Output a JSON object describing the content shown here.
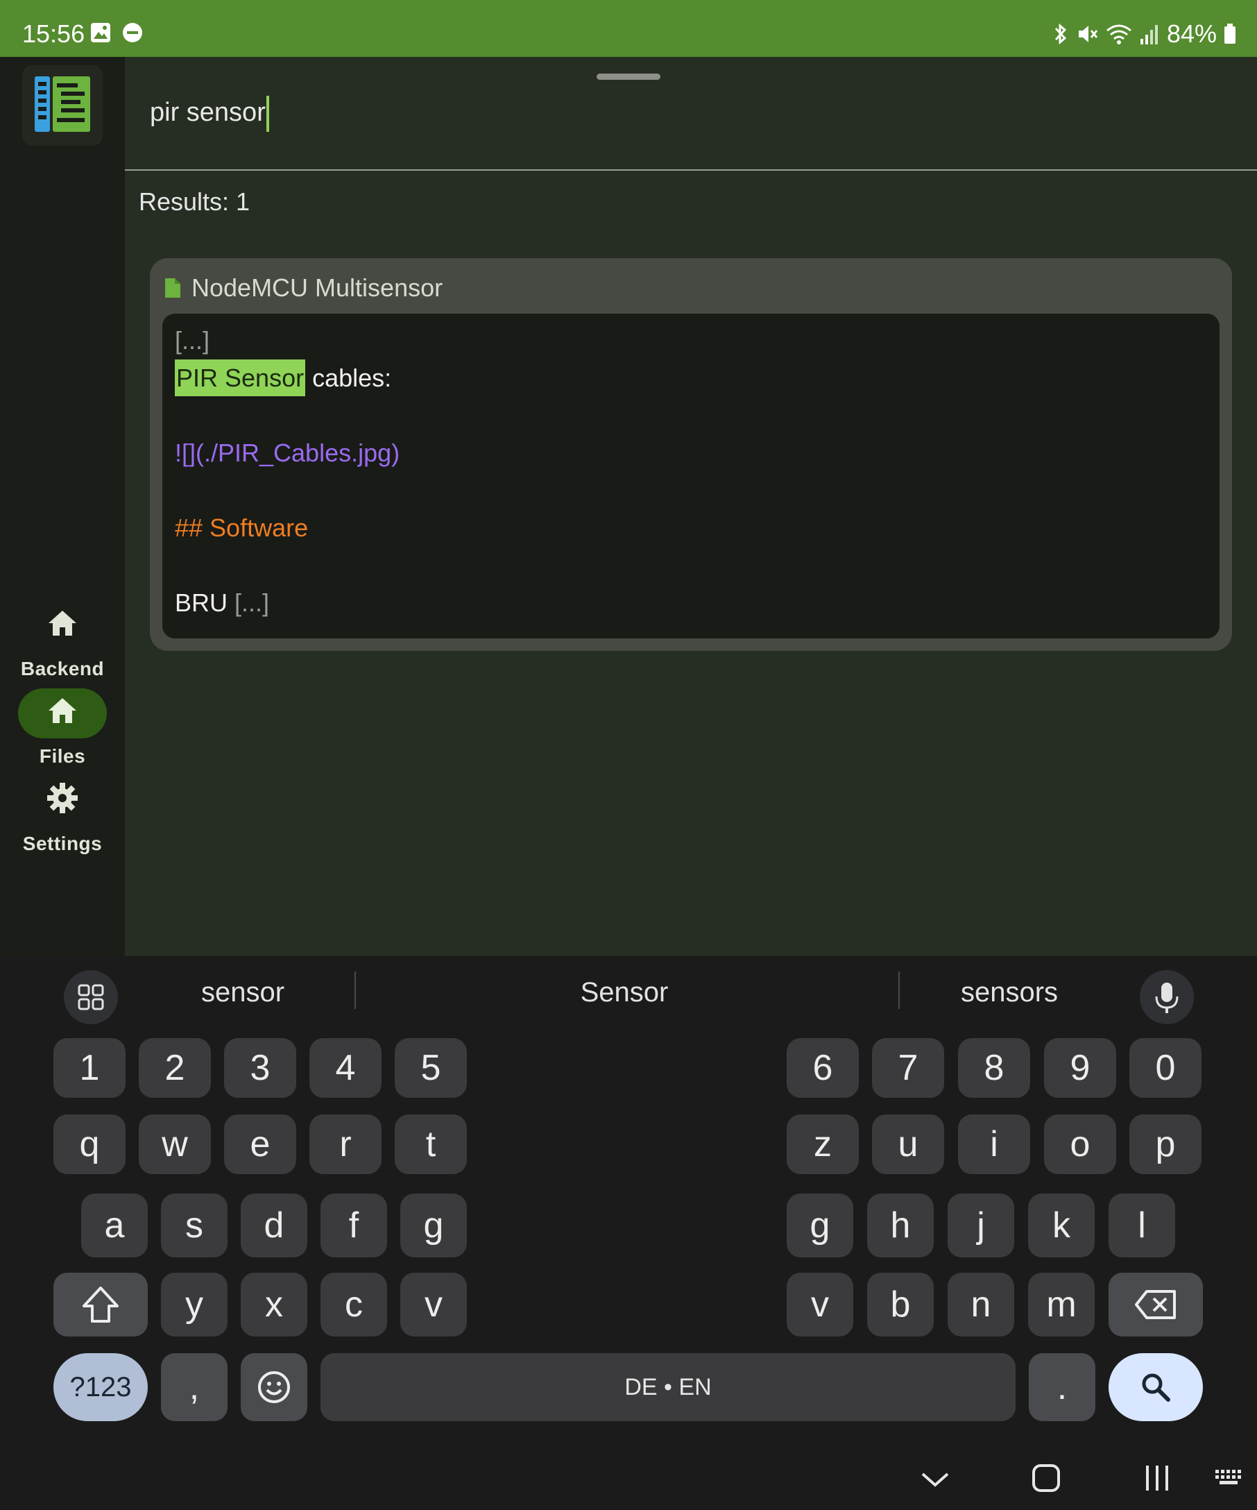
{
  "status_bar": {
    "time": "15:56",
    "left_icons": [
      "image-icon",
      "do-not-disturb-icon"
    ],
    "right_icons": [
      "bluetooth-icon",
      "mute-icon",
      "wifi-icon",
      "signal-icon",
      "battery-icon"
    ],
    "battery": "84%"
  },
  "rail": {
    "logo_icon": "app-logo-icon",
    "items": [
      {
        "label": "Backend",
        "icon": "home-icon",
        "selected": false
      },
      {
        "label": "Files",
        "icon": "home-icon",
        "selected": true
      },
      {
        "label": "Settings",
        "icon": "gear-icon",
        "selected": false
      }
    ]
  },
  "search": {
    "query": "pir sensor",
    "results_label": "Results: 1"
  },
  "result_card": {
    "title": "NodeMCU Multisensor",
    "file_icon": "file-icon",
    "lines": {
      "ellipsis_top": "[...]",
      "highlight": "PIR Sensor",
      "after_highlight": " cables:",
      "image_link": "![](./PIR_Cables.jpg)",
      "heading": "## Software",
      "last_text": "BRU ",
      "ellipsis_bottom": "[...]"
    }
  },
  "keyboard": {
    "suggestions": [
      "sensor",
      "Sensor",
      "sensors"
    ],
    "number_row_left": [
      "1",
      "2",
      "3",
      "4",
      "5"
    ],
    "number_row_right": [
      "6",
      "7",
      "8",
      "9",
      "0"
    ],
    "row1_left": [
      "q",
      "w",
      "e",
      "r",
      "t"
    ],
    "row1_right": [
      "z",
      "u",
      "i",
      "o",
      "p"
    ],
    "row2_left": [
      "a",
      "s",
      "d",
      "f",
      "g"
    ],
    "row2_right": [
      "g",
      "h",
      "j",
      "k",
      "l"
    ],
    "row3_left": [
      "y",
      "x",
      "c",
      "v"
    ],
    "row3_right": [
      "v",
      "b",
      "n",
      "m"
    ],
    "symbols_label": "?123",
    "comma": ",",
    "space_label": "DE • EN",
    "period": ".",
    "colors": {
      "accent": "#548c2f",
      "highlight": "#8fd457"
    }
  }
}
